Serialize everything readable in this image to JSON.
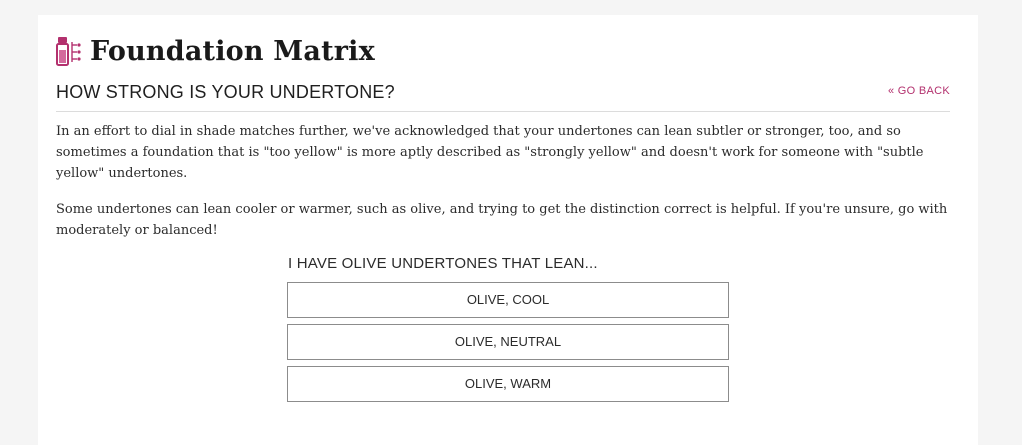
{
  "brand": {
    "title": "Foundation Matrix",
    "icon": "foundation-bottle-icon",
    "accent_color": "#b3316e"
  },
  "header": {
    "heading": "HOW STRONG IS YOUR UNDERTONE?",
    "go_back": "« GO BACK"
  },
  "body": {
    "paragraph_1": "In an effort to dial in shade matches further, we've acknowledged that your undertones can lean subtler or stronger, too, and so sometimes a foundation that is \"too yellow\" is more aptly described as \"strongly yellow\" and doesn't work for someone with \"subtle yellow\" undertones.",
    "paragraph_2": "Some undertones can lean cooler or warmer, such as olive, and trying to get the distinction correct is helpful. If you're unsure, go with moderately or balanced!"
  },
  "question": {
    "prompt": "I HAVE OLIVE UNDERTONES THAT LEAN...",
    "options": [
      {
        "label": "OLIVE, COOL"
      },
      {
        "label": "OLIVE, NEUTRAL"
      },
      {
        "label": "OLIVE, WARM"
      }
    ]
  }
}
